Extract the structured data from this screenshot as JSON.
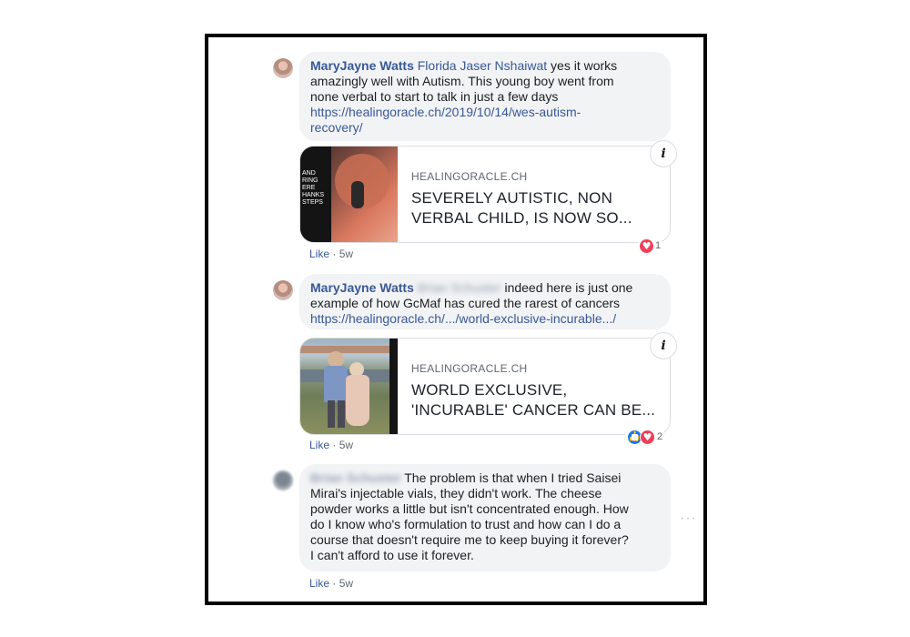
{
  "comments": [
    {
      "author": "MaryJayne Watts",
      "tagged": "Florida Jaser Nshaiwat",
      "text_lines": [
        " yes it works",
        "amazingly well with Autism. This young boy went from",
        "none verbal to start to talk in just a few days"
      ],
      "link_lines": [
        "https://healingoracle.ch/2019/10/14/wes-autism-",
        "recovery/"
      ],
      "preview": {
        "domain": "HEALINGORACLE.CH",
        "title_lines": [
          "SEVERELY AUTISTIC, NON",
          "VERBAL CHILD, IS NOW SO..."
        ],
        "thumb_text": [
          "AND",
          "RING",
          "ERE",
          "HANKS",
          "STEPS"
        ],
        "info": "i"
      },
      "like_label": "Like",
      "time": "5w",
      "reaction_count": "1"
    },
    {
      "author": "MaryJayne Watts",
      "tagged_blurred": "Brian Schuster",
      "text_lines": [
        " indeed here is just one",
        "example of how GcMaf has cured the rarest of cancers"
      ],
      "link_lines": [
        "https://healingoracle.ch/.../world-exclusive-incurable.../"
      ],
      "preview": {
        "domain": "HEALINGORACLE.CH",
        "title_lines": [
          "WORLD EXCLUSIVE,",
          "'INCURABLE' CANCER CAN BE..."
        ],
        "info": "i"
      },
      "like_label": "Like",
      "time": "5w",
      "reaction_count": "2"
    },
    {
      "author_blurred": "Brian Schuster",
      "text_lines": [
        " The problem is that when I tried Saisei",
        "Mirai's injectable vials, they didn't work. The cheese",
        "powder works a little but isn't concentrated enough. How",
        "do I know who's formulation to trust and how can I do a",
        "course that doesn't require me to keep buying it forever?",
        "I can't afford to use it forever."
      ],
      "like_label": "Like",
      "time": "5w",
      "more_label": "···"
    }
  ],
  "colors": {
    "link": "#385898",
    "bubble": "#f2f3f5",
    "meta": "#606770"
  }
}
